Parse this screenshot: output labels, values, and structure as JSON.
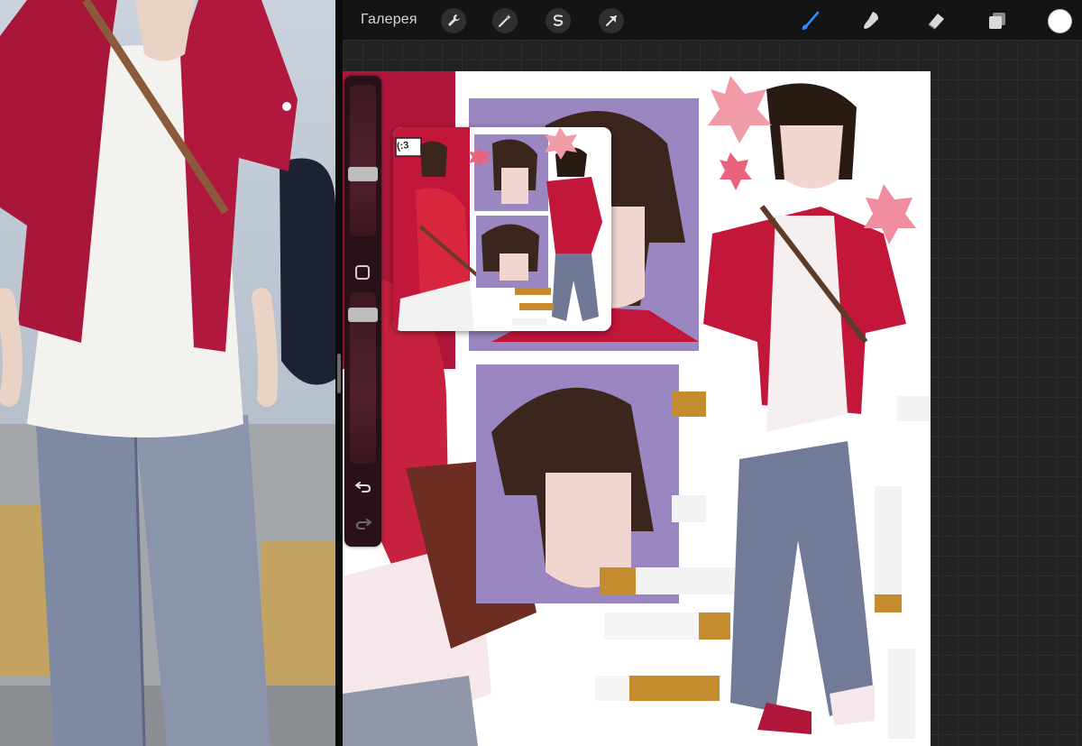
{
  "app": {
    "gallery_label": "Галерея"
  },
  "toolbar": {
    "left_tools": [
      "wrench-icon",
      "magic-wand-icon",
      "selection-icon",
      "transform-arrow-icon"
    ],
    "right_tools": [
      "brush-icon",
      "smudge-icon",
      "eraser-icon",
      "layers-icon"
    ],
    "active_tool": "brush-icon",
    "accent_color": "#2f8cff",
    "current_color": "#ffffff"
  },
  "sidebar": {
    "size_slider_level": 0.4,
    "opacity_slider_level": 0.9,
    "undo_icon": "undo-icon",
    "redo_icon": "redo-icon",
    "modify_icon": "square-modify-icon"
  },
  "reference": {
    "sticker_text": "(:3"
  },
  "colors": {
    "jacket_red": "#b0163a",
    "lavender": "#9a87c2",
    "denim": "#7d8aa8",
    "hair": "#3b261d",
    "skin": "#f0d6cf"
  }
}
